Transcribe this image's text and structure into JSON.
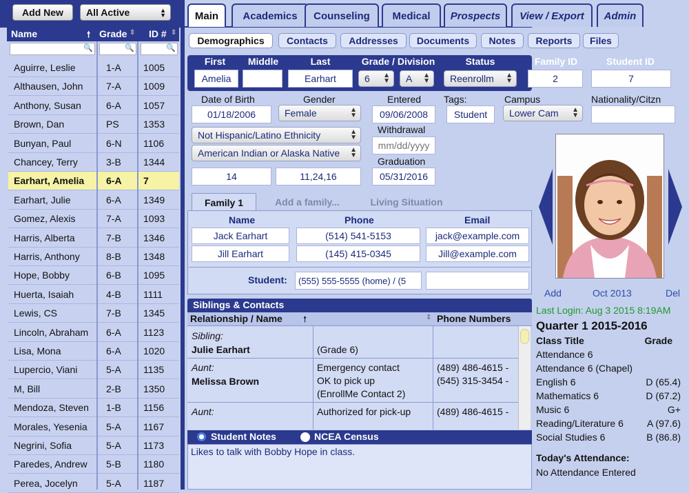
{
  "left": {
    "add_new_label": "Add New",
    "filter_value": "All Active",
    "columns": {
      "name": "Name",
      "grade": "Grade",
      "id": "ID #"
    },
    "students": [
      {
        "name": "Aguirre, Leslie",
        "grade": "1-A",
        "id": "1005"
      },
      {
        "name": "Althausen, John",
        "grade": "7-A",
        "id": "1009"
      },
      {
        "name": "Anthony, Susan",
        "grade": "6-A",
        "id": "1057"
      },
      {
        "name": "Brown, Dan",
        "grade": "PS",
        "id": "1353"
      },
      {
        "name": "Bunyan, Paul",
        "grade": "6-N",
        "id": "1106"
      },
      {
        "name": "Chancey, Terry",
        "grade": "3-B",
        "id": "1344"
      },
      {
        "name": "Earhart, Amelia",
        "grade": "6-A",
        "id": "7"
      },
      {
        "name": "Earhart, Julie",
        "grade": "6-A",
        "id": "1349"
      },
      {
        "name": "Gomez, Alexis",
        "grade": "7-A",
        "id": "1093"
      },
      {
        "name": "Harris, Alberta",
        "grade": "7-B",
        "id": "1346"
      },
      {
        "name": "Harris, Anthony",
        "grade": "8-B",
        "id": "1348"
      },
      {
        "name": "Hope, Bobby",
        "grade": "6-B",
        "id": "1095"
      },
      {
        "name": "Huerta, Isaiah",
        "grade": "4-B",
        "id": "1111"
      },
      {
        "name": "Lewis, CS",
        "grade": "7-B",
        "id": "1345"
      },
      {
        "name": "Lincoln, Abraham",
        "grade": "6-A",
        "id": "1123"
      },
      {
        "name": "Lisa, Mona",
        "grade": "6-A",
        "id": "1020"
      },
      {
        "name": "Lupercio, Viani",
        "grade": "5-A",
        "id": "1135"
      },
      {
        "name": "M, Bill",
        "grade": "2-B",
        "id": "1350"
      },
      {
        "name": "Mendoza, Steven",
        "grade": "1-B",
        "id": "1156"
      },
      {
        "name": "Morales, Yesenia",
        "grade": "5-A",
        "id": "1167"
      },
      {
        "name": "Negrini, Sofia",
        "grade": "5-A",
        "id": "1173"
      },
      {
        "name": "Paredes, Andrew",
        "grade": "5-B",
        "id": "1180"
      },
      {
        "name": "Perea, Jocelyn",
        "grade": "5-A",
        "id": "1187"
      }
    ]
  },
  "tabs": [
    "Main",
    "Academics",
    "Counseling",
    "Medical",
    "Prospects",
    "View / Export",
    "Admin"
  ],
  "subtabs": [
    "Demographics",
    "Contacts",
    "Addresses",
    "Documents",
    "Notes",
    "Reports",
    "Files"
  ],
  "header": {
    "first": "First",
    "middle": "Middle",
    "last": "Last",
    "grade_division": "Grade / Division",
    "status": "Status",
    "family_id": "Family ID",
    "student_id": "Student ID"
  },
  "student": {
    "first": "Amelia",
    "middle": "",
    "last": "Earhart",
    "grade": "6",
    "division": "A",
    "status": "Reenrollm",
    "family_id": "2",
    "student_id": "7"
  },
  "demo": {
    "dob_label": "Date of Birth",
    "dob": "01/18/2006",
    "gender_label": "Gender",
    "gender": "Female",
    "entered_label": "Entered",
    "entered": "09/06/2008",
    "tags_label": "Tags:",
    "tags": "Student",
    "campus_label": "Campus",
    "campus": "Lower Cam",
    "nationality_label": "Nationality/Citzn",
    "nationality": "",
    "ethnicity": "Not Hispanic/Latino Ethnicity",
    "race": "American Indian or Alaska Native",
    "withdrawal_label": "Withdrawal",
    "withdrawal_placeholder": "mm/dd/yyyy",
    "graduation_label": "Graduation",
    "graduation": "05/31/2016",
    "field_a": "14",
    "field_b": "11,24,16"
  },
  "family": {
    "tabs": [
      "Family 1",
      "Add a family...",
      "Living Situation"
    ],
    "col_name": "Name",
    "col_phone": "Phone",
    "col_email": "Email",
    "members": [
      {
        "name": "Jack Earhart",
        "phone": "(514) 541-5153",
        "email": "jack@example.com"
      },
      {
        "name": "Jill Earhart",
        "phone": "(145) 415-0345",
        "email": "Jill@example.com"
      }
    ],
    "student_label": "Student:",
    "student_phone": "(555) 555-5555 (home) / (5"
  },
  "siblings": {
    "title": "Siblings & Contacts",
    "col_rel": "Relationship / Name",
    "col_phone": "Phone Numbers",
    "rows": [
      {
        "rel": "Sibling:",
        "name": "Julie Earhart",
        "info": [
          "(Grade 6)"
        ],
        "phones": []
      },
      {
        "rel": "Aunt:",
        "name": "Melissa Brown",
        "info": [
          "Emergency contact",
          "OK to pick up",
          "(EnrollMe Contact 2)"
        ],
        "phones": [
          "(489) 486-4615 -",
          "(545) 315-3454 -"
        ]
      },
      {
        "rel": "Aunt:",
        "name": "",
        "info": [
          "Authorized for pick-up"
        ],
        "phones": [
          "(489) 486-4615 -"
        ]
      }
    ]
  },
  "notes": {
    "tab1": "Student Notes",
    "tab2": "NCEA Census",
    "text": "Likes to talk with Bobby Hope in class."
  },
  "photo": {
    "add": "Add",
    "date": "Oct 2013",
    "del": "Del"
  },
  "right": {
    "last_login": "Last Login: Aug 3 2015 8:19AM",
    "quarter": "Quarter 1 2015-2016",
    "col_class": "Class Title",
    "col_grade": "Grade",
    "grades": [
      {
        "title": "Attendance 6",
        "grade": ""
      },
      {
        "title": "Attendance 6 (Chapel)",
        "grade": ""
      },
      {
        "title": "English 6",
        "grade": "D (65.4)"
      },
      {
        "title": "Mathematics 6",
        "grade": "D (67.2)"
      },
      {
        "title": "Music 6",
        "grade": "G+"
      },
      {
        "title": "Reading/Literature 6",
        "grade": "A (97.6)"
      },
      {
        "title": "Social Studies 6",
        "grade": "B (86.8)"
      }
    ],
    "attendance_title": "Today's Attendance:",
    "attendance_text": "No Attendance Entered"
  },
  "colors": {
    "navy": "#2b3a8e",
    "panel": "#c5d0ee",
    "highlight": "#f6f3a6",
    "login_green": "#1e9a2a"
  }
}
